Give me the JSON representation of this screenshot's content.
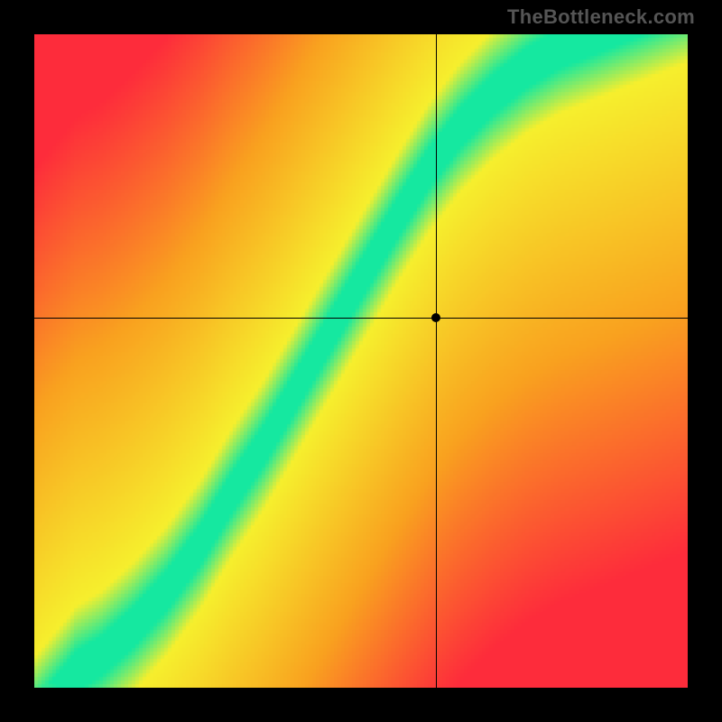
{
  "watermark": "TheBottleneck.com",
  "chart_data": {
    "type": "heatmap",
    "title": "",
    "xlabel": "",
    "ylabel": "",
    "xlim": [
      0,
      1
    ],
    "ylim": [
      0,
      1
    ],
    "crosshair": {
      "x": 0.616,
      "y": 0.566
    },
    "optimal_ridge": [
      {
        "x": 0.0,
        "y": 0.0
      },
      {
        "x": 0.05,
        "y": 0.02
      },
      {
        "x": 0.1,
        "y": 0.05
      },
      {
        "x": 0.15,
        "y": 0.095
      },
      {
        "x": 0.2,
        "y": 0.15
      },
      {
        "x": 0.25,
        "y": 0.218
      },
      {
        "x": 0.3,
        "y": 0.3
      },
      {
        "x": 0.35,
        "y": 0.375
      },
      {
        "x": 0.4,
        "y": 0.46
      },
      {
        "x": 0.45,
        "y": 0.545
      },
      {
        "x": 0.5,
        "y": 0.63
      },
      {
        "x": 0.55,
        "y": 0.715
      },
      {
        "x": 0.6,
        "y": 0.795
      },
      {
        "x": 0.65,
        "y": 0.86
      },
      {
        "x": 0.7,
        "y": 0.91
      },
      {
        "x": 0.75,
        "y": 0.95
      },
      {
        "x": 0.8,
        "y": 0.98
      },
      {
        "x": 0.85,
        "y": 1.0
      }
    ],
    "ridge_core_halfwidth_y": 0.03,
    "yellow_halo_halfwidth_y": 0.1,
    "colors": {
      "optimal": "#15e8a0",
      "near": "#f6ef2d",
      "moderate": "#f9a11f",
      "bad": "#fd2c3b"
    },
    "point": {
      "x": 0.616,
      "y": 0.566,
      "in_green_band": false
    }
  }
}
